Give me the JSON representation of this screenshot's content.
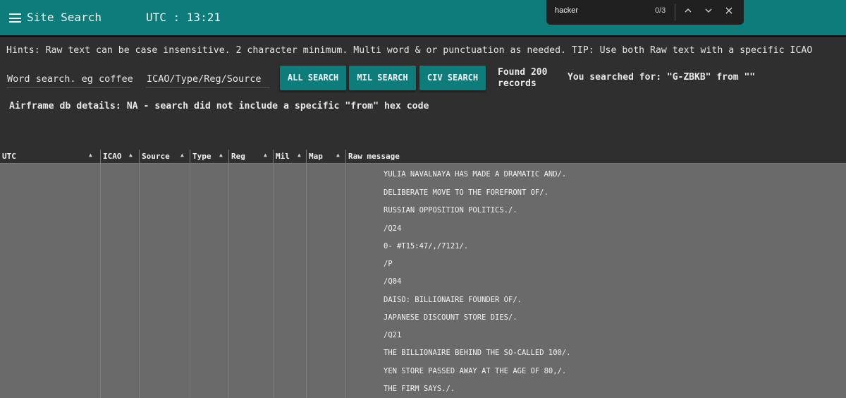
{
  "header": {
    "title": "Site Search",
    "clock": "UTC : 13:21"
  },
  "find_bar": {
    "query": "hacker",
    "count": "0/3",
    "prev_icon": "chevron-up-icon",
    "next_icon": "chevron-down-icon",
    "close_icon": "close-icon"
  },
  "hints": "Hints: Raw text can be case insensitive. 2 character minimum. Multi word & or punctuation as needed. TIP: Use both Raw text with a specific ICAO",
  "search": {
    "word_placeholder": "Word search. eg coffee",
    "icao_placeholder": "ICAO/Type/Reg/Source",
    "buttons": {
      "all": "ALL SEARCH",
      "mil": "MIL SEARCH",
      "civ": "CIV SEARCH"
    },
    "found_line1": "Found 200",
    "found_line2": "records",
    "searched_for": "You searched for: \"G-ZBKB\" from \"\""
  },
  "airframe": "Airframe db details: NA - search did not include a specific \"from\" hex code",
  "table": {
    "columns": [
      "UTC",
      "ICAO",
      "Source",
      "Type",
      "Reg",
      "Mil",
      "Map",
      "Raw message"
    ],
    "raw_lines": [
      "YULIA NAVALNAYA HAS MADE A DRAMATIC AND/.",
      "DELIBERATE MOVE TO THE FOREFRONT OF/.",
      "RUSSIAN OPPOSITION POLITICS./.",
      "/Q24",
      "0- #T15:47/,/7121/.",
      "/P",
      "/Q04",
      "DAISO: BILLIONAIRE FOUNDER OF/.",
      "JAPANESE DISCOUNT STORE DIES/.",
      "/Q21",
      "THE BILLIONAIRE BEHIND THE SO-CALLED 100/.",
      "YEN STORE PASSED AWAY AT THE AGE OF 80,/.",
      "THE FIRM SAYS./."
    ]
  },
  "colors": {
    "accent": "#0e7c7b",
    "background": "#2f2f2f",
    "table_body": "#6a6a6a"
  }
}
